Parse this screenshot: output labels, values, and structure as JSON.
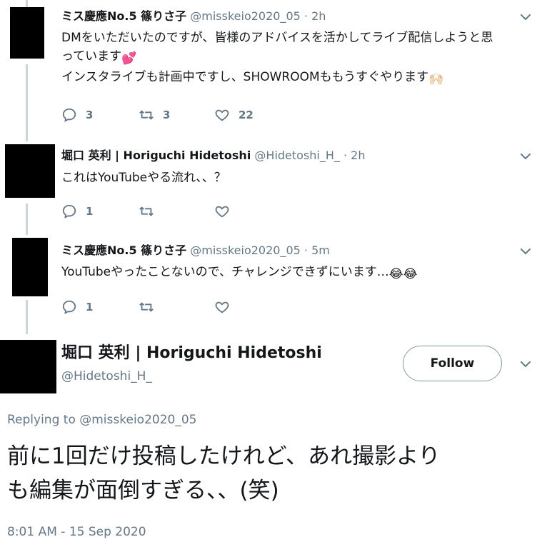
{
  "tweets": [
    {
      "name": "ミス慶應No.5 篠りさ子",
      "handle": "@misskeio2020_05",
      "time": "· 2h",
      "lines": [
        "DMをいただいたのですが、皆様のアドバイスを活かしてライブ配信しようと思",
        "っています",
        "インスタライブも計画中ですし、SHOWROOMももうすぐやります"
      ],
      "emoji_heart": "💕",
      "emoji_hands": "🙌🏻",
      "replies": "3",
      "retweets": "3",
      "likes": "22"
    },
    {
      "name": "堀口 英利 | Horiguchi Hidetoshi",
      "handle": "@Hidetoshi_H_",
      "time": "· 2h",
      "text": "これはYouTubeやる流れ、、？",
      "replies": "1",
      "retweets": "",
      "likes": ""
    },
    {
      "name": "ミス慶應No.5 篠りさ子",
      "handle": "@misskeio2020_05",
      "time": "· 5m",
      "text": "YouTubeやったことないので、チャレンジできずにいます…",
      "emoji": "😂😂",
      "replies": "1",
      "retweets": "",
      "likes": ""
    }
  ],
  "main_tweet": {
    "name": "堀口 英利 | Horiguchi Hidetoshi",
    "handle": "@Hidetoshi_H_",
    "follow_label": "Follow",
    "replying_prefix": "Replying to",
    "replying_handle": "@misskeio2020_05",
    "text_line1": "前に1回だけ投稿したけれど、あれ撮影より",
    "text_line2": "も編集が面倒すぎる、、(笑)",
    "timestamp": "8:01 AM - 15 Sep 2020"
  },
  "icons": {
    "reply": "reply-icon",
    "retweet": "retweet-icon",
    "like": "heart-icon",
    "caret": "chevron-down-icon"
  },
  "colors": {
    "text": "#14171a",
    "secondary": "#657786",
    "thread_line": "#ccd6dd"
  }
}
